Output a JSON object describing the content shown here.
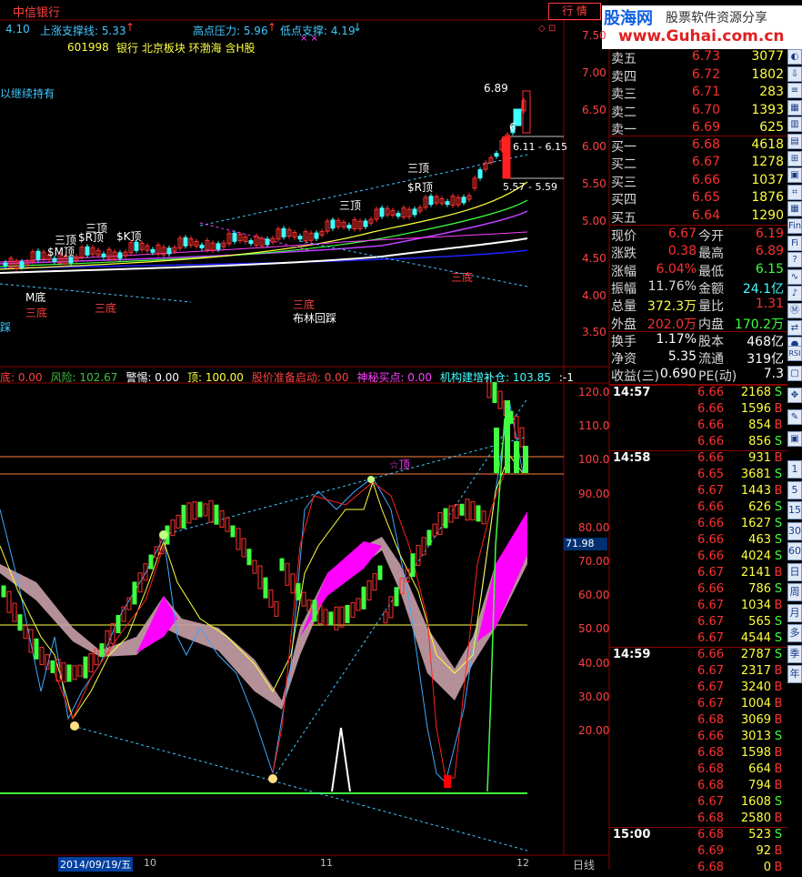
{
  "top_bar": {
    "code_left": "4.10",
    "stock_name": "中信银行",
    "support_line": "上涨支撑线: 5.33",
    "high_pressure": "高点压力: 5.96",
    "low_support": "低点支撑: 4.19",
    "stock_code": "601998",
    "tags": "银行 北京板块 环渤海 含H股",
    "hold_note": "以继续持有",
    "trade_button": "行  情",
    "brand": "股海网",
    "brand_slogan": "股票软件资源分享",
    "brand_url": "www.Guhai.com.cn"
  },
  "price_axis": [
    "7.50",
    "7.00",
    "6.50",
    "6.00",
    "5.50",
    "5.00",
    "4.50",
    "4.00",
    "3.50"
  ],
  "price_annotations": {
    "high": "6.89",
    "range1": "6.11 - 6.15",
    "range2": "5.57 - 5.59",
    "six": "6"
  },
  "signals": {
    "top_labels": [
      "三顶",
      "$R顶",
      "三顶",
      "三顶",
      "$R顶",
      "$K顶",
      "$M顶",
      "三顶"
    ],
    "bottom_labels": [
      "M底",
      "三底",
      "三底",
      "三底",
      "布林回踩",
      "三底",
      "踩"
    ]
  },
  "indicator_bar": {
    "items": [
      {
        "label": "底: 0.00",
        "color": "#ff4040"
      },
      {
        "label": "风险: 102.67",
        "color": "#40c040"
      },
      {
        "label": "警惕: 0.00",
        "color": "#ffffff"
      },
      {
        "label": "顶: 100.00",
        "color": "#ffff40"
      },
      {
        "label": "股价准备启动: 0.00",
        "color": "#ff4040"
      },
      {
        "label": "神秘买点: 0.00",
        "color": "#ff40ff"
      },
      {
        "label": "机构建增补仓: 103.85",
        "color": "#40ffff"
      },
      {
        "label": ":-1",
        "color": "#ffffff"
      }
    ]
  },
  "indicator_axis": [
    "120.0",
    "110.0",
    "100.0",
    "90.00",
    "80.00",
    "70.00",
    "60.00",
    "50.00",
    "40.00",
    "30.00",
    "20.00"
  ],
  "indicator_value": "71.98",
  "indicator_star": "☆顶",
  "date_axis": {
    "date": "2014/09/19/五",
    "m10": "10",
    "m11": "11",
    "m12": "12",
    "period": "日线"
  },
  "quotes": {
    "asks": [
      {
        "name": "卖五",
        "price": "6.73",
        "vol": "3077"
      },
      {
        "name": "卖四",
        "price": "6.72",
        "vol": "1802"
      },
      {
        "name": "卖三",
        "price": "6.71",
        "vol": "283"
      },
      {
        "name": "卖二",
        "price": "6.70",
        "vol": "1393"
      },
      {
        "name": "卖一",
        "price": "6.69",
        "vol": "625"
      }
    ],
    "bids": [
      {
        "name": "买一",
        "price": "6.68",
        "vol": "4618"
      },
      {
        "name": "买二",
        "price": "6.67",
        "vol": "1278"
      },
      {
        "name": "买三",
        "price": "6.66",
        "vol": "1037"
      },
      {
        "name": "买四",
        "price": "6.65",
        "vol": "1876"
      },
      {
        "name": "买五",
        "price": "6.64",
        "vol": "1290"
      }
    ]
  },
  "stats": [
    {
      "l1": "现价",
      "v1": "6.67",
      "c1": "#ff3030",
      "l2": "今开",
      "v2": "6.19",
      "c2": "#ff3030"
    },
    {
      "l1": "涨跌",
      "v1": "0.38",
      "c1": "#ff3030",
      "l2": "最高",
      "v2": "6.89",
      "c2": "#ff3030"
    },
    {
      "l1": "涨幅",
      "v1": "6.04%",
      "c1": "#ff3030",
      "l2": "最低",
      "v2": "6.15",
      "c2": "#40ff40"
    },
    {
      "l1": "振幅",
      "v1": "11.76%",
      "c1": "#d8d8d8",
      "l2": "金额",
      "v2": "24.1亿",
      "c2": "#40ffff"
    },
    {
      "l1": "总量",
      "v1": "372.3万",
      "c1": "#ffff40",
      "l2": "量比",
      "v2": "1.31",
      "c2": "#ff3030"
    },
    {
      "l1": "外盘",
      "v1": "202.0万",
      "c1": "#ff3030",
      "l2": "内盘",
      "v2": "170.2万",
      "c2": "#40ff40"
    }
  ],
  "stats2": [
    {
      "l1": "换手",
      "v1": "1.17%",
      "l2": "股本",
      "v2": "468亿"
    },
    {
      "l1": "净资",
      "v1": "5.35",
      "l2": "流通",
      "v2": "319亿"
    },
    {
      "l1": "收益(三)",
      "v1": "0.690",
      "l2": "PE(动)",
      "v2": "7.3"
    }
  ],
  "ticks": [
    {
      "time": "14:57",
      "price": "6.66",
      "vol": "2168",
      "dir": "S"
    },
    {
      "time": "",
      "price": "6.66",
      "vol": "1596",
      "dir": "B"
    },
    {
      "time": "",
      "price": "6.66",
      "vol": "854",
      "dir": "B"
    },
    {
      "time": "",
      "price": "6.66",
      "vol": "856",
      "dir": "S"
    },
    {
      "time": "14:58",
      "price": "6.66",
      "vol": "931",
      "dir": "B"
    },
    {
      "time": "",
      "price": "6.65",
      "vol": "3681",
      "dir": "S"
    },
    {
      "time": "",
      "price": "6.67",
      "vol": "1443",
      "dir": "B"
    },
    {
      "time": "",
      "price": "6.66",
      "vol": "626",
      "dir": "S"
    },
    {
      "time": "",
      "price": "6.66",
      "vol": "1627",
      "dir": "S"
    },
    {
      "time": "",
      "price": "6.66",
      "vol": "463",
      "dir": "S"
    },
    {
      "time": "",
      "price": "6.66",
      "vol": "4024",
      "dir": "S"
    },
    {
      "time": "",
      "price": "6.67",
      "vol": "2141",
      "dir": "B"
    },
    {
      "time": "",
      "price": "6.66",
      "vol": "786",
      "dir": "S"
    },
    {
      "time": "",
      "price": "6.67",
      "vol": "1034",
      "dir": "B"
    },
    {
      "time": "",
      "price": "6.67",
      "vol": "565",
      "dir": "S"
    },
    {
      "time": "",
      "price": "6.67",
      "vol": "4544",
      "dir": "S"
    },
    {
      "time": "14:59",
      "price": "6.66",
      "vol": "2787",
      "dir": "S"
    },
    {
      "time": "",
      "price": "6.67",
      "vol": "2317",
      "dir": "B"
    },
    {
      "time": "",
      "price": "6.67",
      "vol": "3240",
      "dir": "B"
    },
    {
      "time": "",
      "price": "6.67",
      "vol": "1004",
      "dir": "B"
    },
    {
      "time": "",
      "price": "6.68",
      "vol": "3069",
      "dir": "B"
    },
    {
      "time": "",
      "price": "6.66",
      "vol": "3013",
      "dir": "S"
    },
    {
      "time": "",
      "price": "6.68",
      "vol": "1598",
      "dir": "B"
    },
    {
      "time": "",
      "price": "6.68",
      "vol": "664",
      "dir": "B"
    },
    {
      "time": "",
      "price": "6.68",
      "vol": "794",
      "dir": "B"
    },
    {
      "time": "",
      "price": "6.67",
      "vol": "1608",
      "dir": "S"
    },
    {
      "time": "",
      "price": "6.68",
      "vol": "2580",
      "dir": "B"
    },
    {
      "time": "15:00",
      "price": "6.68",
      "vol": "523",
      "dir": "S"
    },
    {
      "time": "",
      "price": "6.69",
      "vol": "92",
      "dir": "B"
    },
    {
      "time": "",
      "price": "6.68",
      "vol": "0",
      "dir": "B"
    }
  ],
  "toolbar": [
    "1",
    "5",
    "15",
    "30",
    "60",
    "日",
    "周",
    "月",
    "多",
    "季",
    "年"
  ],
  "toolbar_bottom": "RSI"
}
